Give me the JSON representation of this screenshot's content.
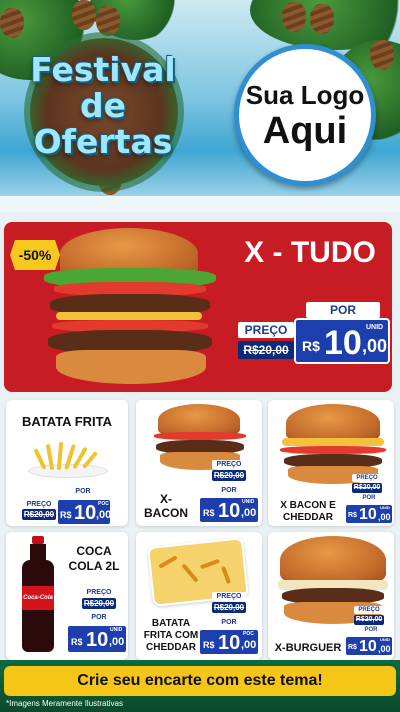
{
  "header": {
    "title_lines": [
      "Festival",
      "de",
      "Ofertas"
    ],
    "logo_line1": "Sua Logo",
    "logo_line2": "Aqui"
  },
  "hero": {
    "discount": "-50%",
    "name": "X - TUDO",
    "por": "POR",
    "preco": "PREÇO",
    "old_price": "R$20,00",
    "currency": "R$",
    "price_int": "10",
    "price_cents": ",00",
    "unit": "UNID"
  },
  "products": [
    {
      "name_lines": [
        "BATATA FRITA"
      ],
      "preco": "PREÇO",
      "old": "R$20,00",
      "por": "POR",
      "cur": "R$",
      "int": "10",
      "cents": ",00",
      "unit": "POC"
    },
    {
      "name_lines": [
        "X-",
        "BACON"
      ],
      "preco": "PREÇO",
      "old": "R$20,00",
      "por": "POR",
      "cur": "R$",
      "int": "10",
      "cents": ",00",
      "unit": "UNID"
    },
    {
      "name_lines": [
        "X BACON E",
        "CHEDDAR"
      ],
      "preco": "PREÇO",
      "old": "R$20,00",
      "por": "POR",
      "cur": "R$",
      "int": "10",
      "cents": ",00",
      "unit": "UNID"
    },
    {
      "name_lines": [
        "COCA",
        "COLA 2L"
      ],
      "preco": "PREÇO",
      "old": "R$20,00",
      "por": "POR",
      "cur": "R$",
      "int": "10",
      "cents": ",00",
      "unit": "UNID"
    },
    {
      "name_lines": [
        "BATATA",
        "FRITA COM",
        "CHEDDAR"
      ],
      "preco": "PREÇO",
      "old": "R$20,00",
      "por": "POR",
      "cur": "R$",
      "int": "10",
      "cents": ",00",
      "unit": "POC"
    },
    {
      "name_lines": [
        "X-BURGUER"
      ],
      "preco": "PREÇO",
      "old": "R$20,00",
      "por": "POR",
      "cur": "R$",
      "int": "10",
      "cents": ",00",
      "unit": "UNID"
    }
  ],
  "bottle_label": "Coca-Cola",
  "footer": {
    "cta": "Crie seu encarte com este tema!",
    "disclaimer": "*Imagens Meramente Ilustrativas"
  },
  "colors": {
    "hero_red": "#c81c24",
    "price_blue": "#1d3fae",
    "cta_yellow": "#f5c518",
    "title_cyan": "#9ee7ff"
  }
}
